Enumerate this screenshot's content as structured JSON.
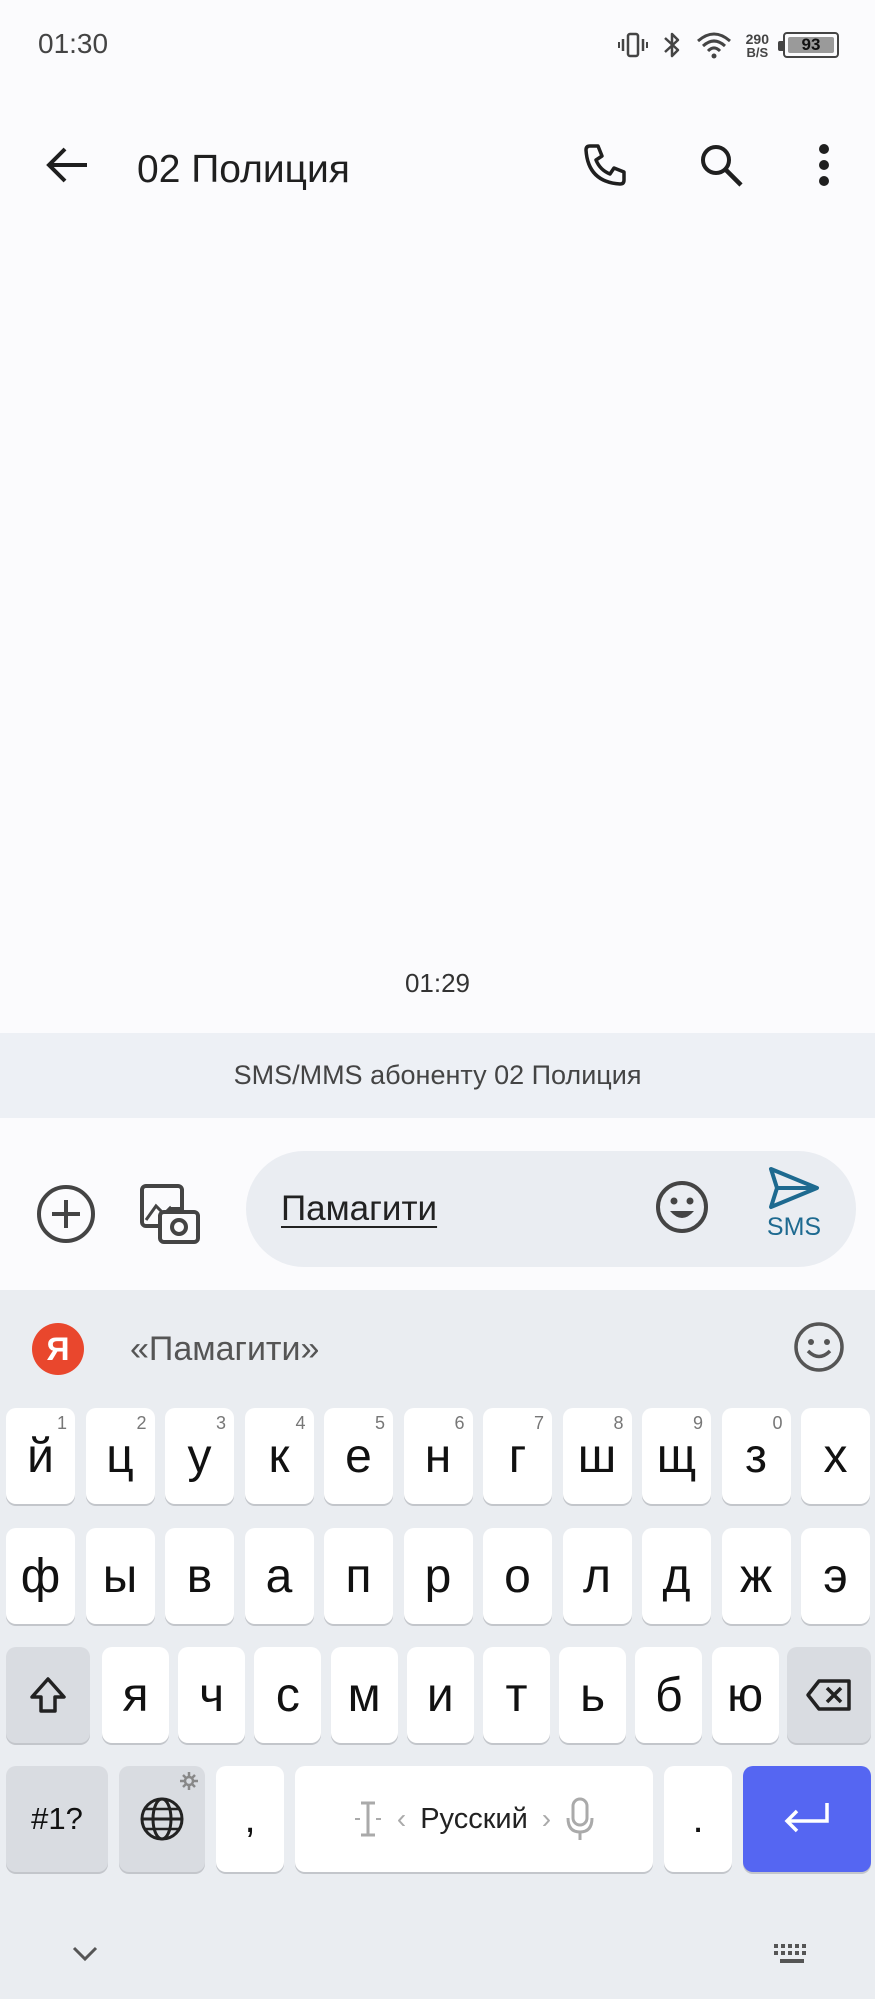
{
  "status_bar": {
    "time": "01:30",
    "net_speed_value": "290",
    "net_speed_unit": "B/S",
    "battery_level": "93",
    "icons": [
      "vibrate-icon",
      "bluetooth-icon",
      "wifi-icon",
      "battery-icon"
    ]
  },
  "app_bar": {
    "title": "02 Полиция",
    "icons": [
      "back-arrow-icon",
      "phone-icon",
      "search-icon",
      "more-vert-icon"
    ]
  },
  "conversation": {
    "last_message_time": "01:29",
    "banner_text": "SMS/MMS абоненту 02 Полиция"
  },
  "compose": {
    "text": "Памагити",
    "send_label": "SMS",
    "accent_color": "#1e6a90"
  },
  "keyboard": {
    "brand_letter": "Я",
    "suggestion": "«Памагити»",
    "row1": [
      {
        "label": "й",
        "hint": "1"
      },
      {
        "label": "ц",
        "hint": "2"
      },
      {
        "label": "у",
        "hint": "3"
      },
      {
        "label": "к",
        "hint": "4"
      },
      {
        "label": "е",
        "hint": "5"
      },
      {
        "label": "н",
        "hint": "6"
      },
      {
        "label": "г",
        "hint": "7"
      },
      {
        "label": "ш",
        "hint": "8"
      },
      {
        "label": "щ",
        "hint": "9"
      },
      {
        "label": "з",
        "hint": "0"
      },
      {
        "label": "х",
        "hint": ""
      }
    ],
    "row2": [
      "ф",
      "ы",
      "в",
      "а",
      "п",
      "р",
      "о",
      "л",
      "д",
      "ж",
      "э"
    ],
    "row3": [
      "я",
      "ч",
      "с",
      "м",
      "и",
      "т",
      "ь",
      "б",
      "ю"
    ],
    "symbols_label": "#1?",
    "comma_label": ",",
    "period_label": ".",
    "language_label": "Русский",
    "enter_color": "#5566f2"
  }
}
